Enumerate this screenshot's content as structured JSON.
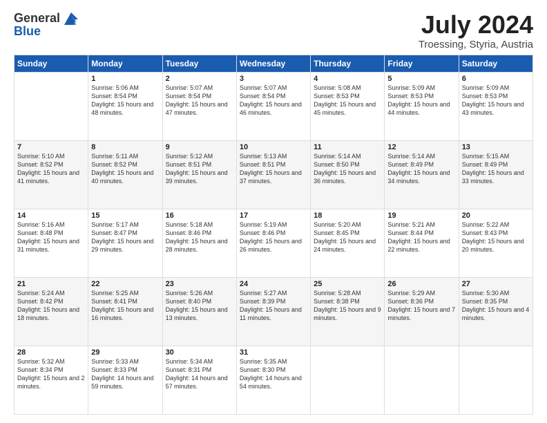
{
  "logo": {
    "general": "General",
    "blue": "Blue"
  },
  "title": {
    "month": "July 2024",
    "location": "Troessing, Styria, Austria"
  },
  "header_row": [
    "Sunday",
    "Monday",
    "Tuesday",
    "Wednesday",
    "Thursday",
    "Friday",
    "Saturday"
  ],
  "weeks": [
    [
      {
        "day": "",
        "sunrise": "",
        "sunset": "",
        "daylight": ""
      },
      {
        "day": "1",
        "sunrise": "Sunrise: 5:06 AM",
        "sunset": "Sunset: 8:54 PM",
        "daylight": "Daylight: 15 hours and 48 minutes."
      },
      {
        "day": "2",
        "sunrise": "Sunrise: 5:07 AM",
        "sunset": "Sunset: 8:54 PM",
        "daylight": "Daylight: 15 hours and 47 minutes."
      },
      {
        "day": "3",
        "sunrise": "Sunrise: 5:07 AM",
        "sunset": "Sunset: 8:54 PM",
        "daylight": "Daylight: 15 hours and 46 minutes."
      },
      {
        "day": "4",
        "sunrise": "Sunrise: 5:08 AM",
        "sunset": "Sunset: 8:53 PM",
        "daylight": "Daylight: 15 hours and 45 minutes."
      },
      {
        "day": "5",
        "sunrise": "Sunrise: 5:09 AM",
        "sunset": "Sunset: 8:53 PM",
        "daylight": "Daylight: 15 hours and 44 minutes."
      },
      {
        "day": "6",
        "sunrise": "Sunrise: 5:09 AM",
        "sunset": "Sunset: 8:53 PM",
        "daylight": "Daylight: 15 hours and 43 minutes."
      }
    ],
    [
      {
        "day": "7",
        "sunrise": "Sunrise: 5:10 AM",
        "sunset": "Sunset: 8:52 PM",
        "daylight": "Daylight: 15 hours and 41 minutes."
      },
      {
        "day": "8",
        "sunrise": "Sunrise: 5:11 AM",
        "sunset": "Sunset: 8:52 PM",
        "daylight": "Daylight: 15 hours and 40 minutes."
      },
      {
        "day": "9",
        "sunrise": "Sunrise: 5:12 AM",
        "sunset": "Sunset: 8:51 PM",
        "daylight": "Daylight: 15 hours and 39 minutes."
      },
      {
        "day": "10",
        "sunrise": "Sunrise: 5:13 AM",
        "sunset": "Sunset: 8:51 PM",
        "daylight": "Daylight: 15 hours and 37 minutes."
      },
      {
        "day": "11",
        "sunrise": "Sunrise: 5:14 AM",
        "sunset": "Sunset: 8:50 PM",
        "daylight": "Daylight: 15 hours and 36 minutes."
      },
      {
        "day": "12",
        "sunrise": "Sunrise: 5:14 AM",
        "sunset": "Sunset: 8:49 PM",
        "daylight": "Daylight: 15 hours and 34 minutes."
      },
      {
        "day": "13",
        "sunrise": "Sunrise: 5:15 AM",
        "sunset": "Sunset: 8:49 PM",
        "daylight": "Daylight: 15 hours and 33 minutes."
      }
    ],
    [
      {
        "day": "14",
        "sunrise": "Sunrise: 5:16 AM",
        "sunset": "Sunset: 8:48 PM",
        "daylight": "Daylight: 15 hours and 31 minutes."
      },
      {
        "day": "15",
        "sunrise": "Sunrise: 5:17 AM",
        "sunset": "Sunset: 8:47 PM",
        "daylight": "Daylight: 15 hours and 29 minutes."
      },
      {
        "day": "16",
        "sunrise": "Sunrise: 5:18 AM",
        "sunset": "Sunset: 8:46 PM",
        "daylight": "Daylight: 15 hours and 28 minutes."
      },
      {
        "day": "17",
        "sunrise": "Sunrise: 5:19 AM",
        "sunset": "Sunset: 8:46 PM",
        "daylight": "Daylight: 15 hours and 26 minutes."
      },
      {
        "day": "18",
        "sunrise": "Sunrise: 5:20 AM",
        "sunset": "Sunset: 8:45 PM",
        "daylight": "Daylight: 15 hours and 24 minutes."
      },
      {
        "day": "19",
        "sunrise": "Sunrise: 5:21 AM",
        "sunset": "Sunset: 8:44 PM",
        "daylight": "Daylight: 15 hours and 22 minutes."
      },
      {
        "day": "20",
        "sunrise": "Sunrise: 5:22 AM",
        "sunset": "Sunset: 8:43 PM",
        "daylight": "Daylight: 15 hours and 20 minutes."
      }
    ],
    [
      {
        "day": "21",
        "sunrise": "Sunrise: 5:24 AM",
        "sunset": "Sunset: 8:42 PM",
        "daylight": "Daylight: 15 hours and 18 minutes."
      },
      {
        "day": "22",
        "sunrise": "Sunrise: 5:25 AM",
        "sunset": "Sunset: 8:41 PM",
        "daylight": "Daylight: 15 hours and 16 minutes."
      },
      {
        "day": "23",
        "sunrise": "Sunrise: 5:26 AM",
        "sunset": "Sunset: 8:40 PM",
        "daylight": "Daylight: 15 hours and 13 minutes."
      },
      {
        "day": "24",
        "sunrise": "Sunrise: 5:27 AM",
        "sunset": "Sunset: 8:39 PM",
        "daylight": "Daylight: 15 hours and 11 minutes."
      },
      {
        "day": "25",
        "sunrise": "Sunrise: 5:28 AM",
        "sunset": "Sunset: 8:38 PM",
        "daylight": "Daylight: 15 hours and 9 minutes."
      },
      {
        "day": "26",
        "sunrise": "Sunrise: 5:29 AM",
        "sunset": "Sunset: 8:36 PM",
        "daylight": "Daylight: 15 hours and 7 minutes."
      },
      {
        "day": "27",
        "sunrise": "Sunrise: 5:30 AM",
        "sunset": "Sunset: 8:35 PM",
        "daylight": "Daylight: 15 hours and 4 minutes."
      }
    ],
    [
      {
        "day": "28",
        "sunrise": "Sunrise: 5:32 AM",
        "sunset": "Sunset: 8:34 PM",
        "daylight": "Daylight: 15 hours and 2 minutes."
      },
      {
        "day": "29",
        "sunrise": "Sunrise: 5:33 AM",
        "sunset": "Sunset: 8:33 PM",
        "daylight": "Daylight: 14 hours and 59 minutes."
      },
      {
        "day": "30",
        "sunrise": "Sunrise: 5:34 AM",
        "sunset": "Sunset: 8:31 PM",
        "daylight": "Daylight: 14 hours and 57 minutes."
      },
      {
        "day": "31",
        "sunrise": "Sunrise: 5:35 AM",
        "sunset": "Sunset: 8:30 PM",
        "daylight": "Daylight: 14 hours and 54 minutes."
      },
      {
        "day": "",
        "sunrise": "",
        "sunset": "",
        "daylight": ""
      },
      {
        "day": "",
        "sunrise": "",
        "sunset": "",
        "daylight": ""
      },
      {
        "day": "",
        "sunrise": "",
        "sunset": "",
        "daylight": ""
      }
    ]
  ]
}
